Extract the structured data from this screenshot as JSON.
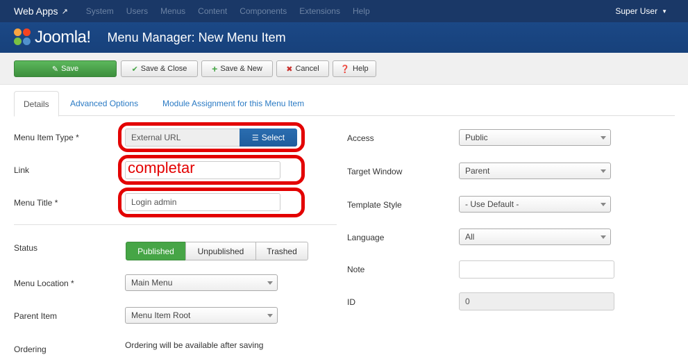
{
  "topnav": {
    "brand": "Web Apps",
    "brand_icon": "external-link-icon",
    "menu": [
      "System",
      "Users",
      "Menus",
      "Content",
      "Components",
      "Extensions",
      "Help"
    ],
    "user": "Super User"
  },
  "header": {
    "logo_text": "Joomla!",
    "title": "Menu Manager: New Menu Item"
  },
  "toolbar": {
    "save": "Save",
    "save_close": "Save & Close",
    "save_new": "Save & New",
    "cancel": "Cancel",
    "help": "Help"
  },
  "tabs": [
    "Details",
    "Advanced Options",
    "Module Assignment for this Menu Item"
  ],
  "form": {
    "menu_item_type_label": "Menu Item Type *",
    "menu_item_type_value": "External URL",
    "select_button": "Select",
    "link_label": "Link",
    "link_annotation": "completar",
    "menu_title_label": "Menu Title *",
    "menu_title_value": "Login admin",
    "status_label": "Status",
    "status_options": [
      "Published",
      "Unpublished",
      "Trashed"
    ],
    "status_selected": "Published",
    "menu_location_label": "Menu Location *",
    "menu_location_value": "Main Menu",
    "parent_item_label": "Parent Item",
    "parent_item_value": "Menu Item Root",
    "ordering_label": "Ordering",
    "ordering_text": "Ordering will be available after saving"
  },
  "right": {
    "access_label": "Access",
    "access_value": "Public",
    "target_window_label": "Target Window",
    "target_window_value": "Parent",
    "template_style_label": "Template Style",
    "template_style_value": "- Use Default -",
    "language_label": "Language",
    "language_value": "All",
    "note_label": "Note",
    "note_value": "",
    "id_label": "ID",
    "id_value": "0"
  },
  "colors": {
    "topnav_bg": "#1a3867",
    "header_bg": "#1b4886",
    "primary_green": "#46a546",
    "select_blue": "#2a6db0",
    "annotation_red": "#e30000",
    "link_blue": "#2a7ac4"
  }
}
